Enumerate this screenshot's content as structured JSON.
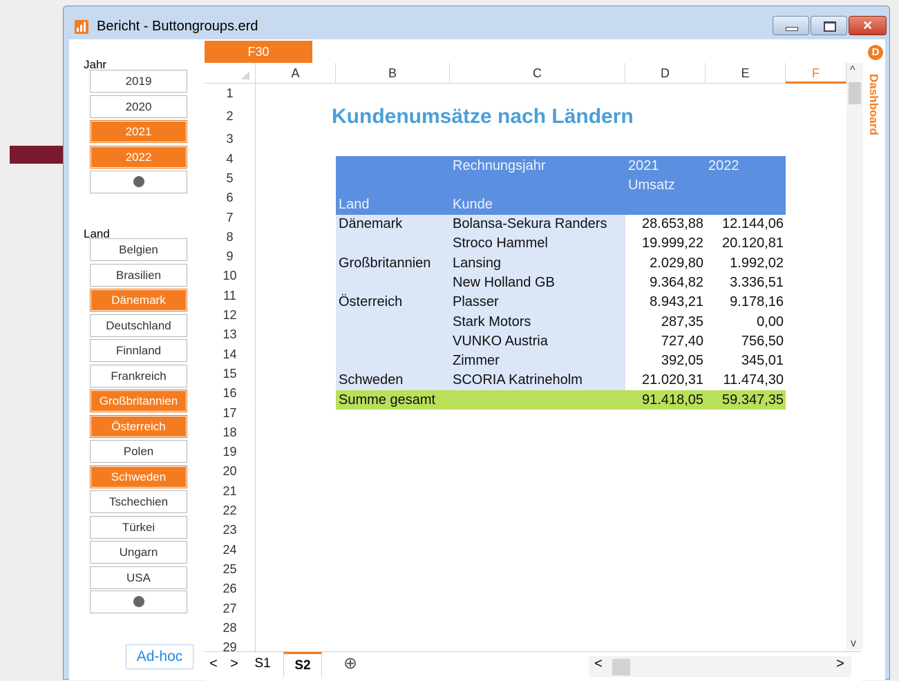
{
  "window": {
    "title": "Bericht - Buttongroups.erd",
    "close_glyph": "✕"
  },
  "jahr": {
    "label": "Jahr",
    "buttons": [
      {
        "label": "2019",
        "selected": false
      },
      {
        "label": "2020",
        "selected": false
      },
      {
        "label": "2021",
        "selected": true
      },
      {
        "label": "2022",
        "selected": true
      }
    ]
  },
  "land": {
    "label": "Land",
    "buttons": [
      {
        "label": "Belgien",
        "selected": false
      },
      {
        "label": "Brasilien",
        "selected": false
      },
      {
        "label": "Dänemark",
        "selected": true
      },
      {
        "label": "Deutschland",
        "selected": false
      },
      {
        "label": "Finnland",
        "selected": false
      },
      {
        "label": "Frankreich",
        "selected": false
      },
      {
        "label": "Großbritannien",
        "selected": true
      },
      {
        "label": "Österreich",
        "selected": true
      },
      {
        "label": "Polen",
        "selected": false
      },
      {
        "label": "Schweden",
        "selected": true
      },
      {
        "label": "Tschechien",
        "selected": false
      },
      {
        "label": "Türkei",
        "selected": false
      },
      {
        "label": "Ungarn",
        "selected": false
      },
      {
        "label": "USA",
        "selected": false
      }
    ]
  },
  "adhoc_label": "Ad-hoc",
  "sheet": {
    "cell_ref": "F30",
    "columns": [
      "A",
      "B",
      "C",
      "D",
      "E",
      "F"
    ],
    "active_column": "F",
    "rows": [
      "1",
      "2",
      "3",
      "4",
      "5",
      "6",
      "7",
      "8",
      "9",
      "10",
      "11",
      "12",
      "13",
      "14",
      "15",
      "16",
      "17",
      "18",
      "19",
      "20",
      "21",
      "22",
      "23",
      "24",
      "25",
      "26",
      "27",
      "28",
      "29"
    ],
    "title": "Kundenumsätze nach Ländern",
    "header": {
      "rechnungsjahr": "Rechnungsjahr",
      "year1": "2021",
      "year2": "2022",
      "umsatz": "Umsatz",
      "land": "Land",
      "kunde": "Kunde"
    },
    "data_rows": [
      {
        "land": "Dänemark",
        "kunde": "Bolansa-Sekura Randers",
        "v2021": "28.653,88",
        "v2022": "12.144,06"
      },
      {
        "land": "",
        "kunde": "Stroco Hammel",
        "v2021": "19.999,22",
        "v2022": "20.120,81"
      },
      {
        "land": "Großbritannien",
        "kunde": "Lansing",
        "v2021": "2.029,80",
        "v2022": "1.992,02"
      },
      {
        "land": "",
        "kunde": "New Holland GB",
        "v2021": "9.364,82",
        "v2022": "3.336,51"
      },
      {
        "land": "Österreich",
        "kunde": "Plasser",
        "v2021": "8.943,21",
        "v2022": "9.178,16"
      },
      {
        "land": "",
        "kunde": "Stark Motors",
        "v2021": "287,35",
        "v2022": "0,00"
      },
      {
        "land": "",
        "kunde": "VUNKO Austria",
        "v2021": "727,40",
        "v2022": "756,50"
      },
      {
        "land": "",
        "kunde": "Zimmer",
        "v2021": "392,05",
        "v2022": "345,01"
      },
      {
        "land": "Schweden",
        "kunde": "SCORIA Katrineholm",
        "v2021": "21.020,31",
        "v2022": "11.474,30"
      }
    ],
    "total": {
      "label": "Summe gesamt",
      "v2021": "91.418,05",
      "v2022": "59.347,35"
    }
  },
  "tabs": [
    {
      "label": "S1",
      "active": false
    },
    {
      "label": "S2",
      "active": true
    }
  ],
  "nav": {
    "prev": "<",
    "next": ">",
    "add": "⊕",
    "scroll_left": "<",
    "scroll_right": ">",
    "scroll_up": "^",
    "scroll_down": "v"
  },
  "dashboard": {
    "badge": "D",
    "label": "Dashboard"
  },
  "colors": {
    "accent": "#f47c20",
    "header_blue": "#5b8fe0",
    "body_blue": "#dbe6f7",
    "total_green": "#b8e05a",
    "arrow": "#7b1a2e"
  }
}
